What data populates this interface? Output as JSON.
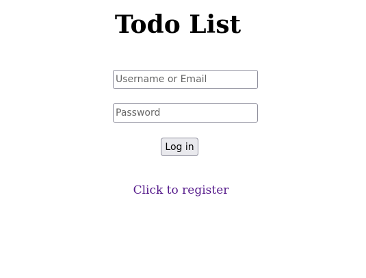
{
  "page": {
    "title": "Todo List"
  },
  "form": {
    "username_placeholder": "Username or Email",
    "username_value": "",
    "password_placeholder": "Password",
    "password_value": "",
    "login_label": "Log in"
  },
  "register": {
    "link_label": "Click to register"
  },
  "colors": {
    "link": "#551a8b",
    "button_bg": "#e9e9ed",
    "field_border": "#8f8f9d"
  }
}
